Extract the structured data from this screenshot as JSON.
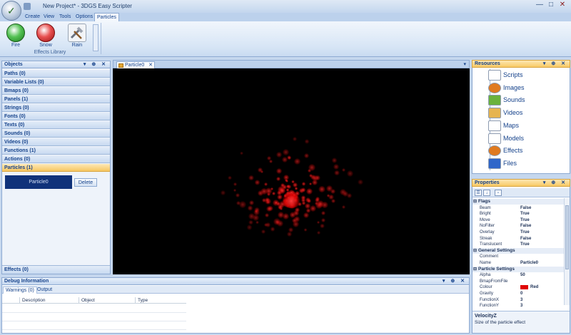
{
  "window": {
    "title": "New Project* - 3DGS Easy Scripter",
    "minimize": "—",
    "maximize": "□",
    "close": "✕"
  },
  "ribbon": {
    "tabs": [
      {
        "label": "Create",
        "active": false
      },
      {
        "label": "View",
        "active": false
      },
      {
        "label": "Tools",
        "active": false
      },
      {
        "label": "Options",
        "active": false
      },
      {
        "label": "Particles",
        "active": true
      }
    ],
    "buttons": [
      {
        "label": "Fire",
        "icon": "fire-icon"
      },
      {
        "label": "Snow",
        "icon": "snow-icon"
      },
      {
        "label": "Rain",
        "icon": "rain-icon"
      }
    ],
    "group_label": "Effects Library"
  },
  "objects_panel": {
    "title": "Objects",
    "header_buttons": "▾ ⊕ ✕",
    "categories": [
      "Paths (0)",
      "Variable Lists (0)",
      "Bmaps (0)",
      "Panels (1)",
      "Strings (0)",
      "Fonts (0)",
      "Texts (0)",
      "Sounds (0)",
      "Videos (0)",
      "Functions (1)",
      "Actions (0)",
      "Particles (1)"
    ],
    "active_category": "Particles (1)",
    "particle_item": "Particle0",
    "delete_label": "Delete",
    "bottom_category": "Effects (0)"
  },
  "document": {
    "tab_label": "Particle0",
    "tab_close": "✕",
    "dropdown": "▾"
  },
  "resources_panel": {
    "title": "Resources",
    "header_buttons": "▾ ⊕ ✕",
    "items": [
      {
        "label": "Scripts",
        "icon": "scripts-icon",
        "color": "#ffffff"
      },
      {
        "label": "Images",
        "icon": "images-icon",
        "color": "#e07a1f"
      },
      {
        "label": "Sounds",
        "icon": "sounds-icon",
        "color": "#6bb23c"
      },
      {
        "label": "Videos",
        "icon": "videos-icon",
        "color": "#e6b450"
      },
      {
        "label": "Maps",
        "icon": "maps-icon",
        "color": "#ffffff"
      },
      {
        "label": "Models",
        "icon": "models-icon",
        "color": "#ffffff"
      },
      {
        "label": "Effects",
        "icon": "effects-icon",
        "color": "#e07a1f"
      },
      {
        "label": "Files",
        "icon": "files-icon",
        "color": "#2f66c9"
      }
    ]
  },
  "properties_panel": {
    "title": "Properties",
    "header_buttons": "▾ ⊕ ✕",
    "categories": [
      {
        "name": "Flags",
        "rows": [
          {
            "name": "Beam",
            "value": "False"
          },
          {
            "name": "Bright",
            "value": "True"
          },
          {
            "name": "Move",
            "value": "True"
          },
          {
            "name": "NoFilter",
            "value": "False"
          },
          {
            "name": "Overlay",
            "value": "True"
          },
          {
            "name": "Streak",
            "value": "False"
          },
          {
            "name": "Translucent",
            "value": "True"
          }
        ]
      },
      {
        "name": "General Settings",
        "rows": [
          {
            "name": "Comment",
            "value": ""
          },
          {
            "name": "Name",
            "value": "Particle0"
          }
        ]
      },
      {
        "name": "Particle Settings",
        "rows": [
          {
            "name": "Alpha",
            "value": "50"
          },
          {
            "name": "BmapFromFile",
            "value": ""
          },
          {
            "name": "Colour",
            "value": "Red",
            "swatch": "#e00000"
          },
          {
            "name": "Gravity",
            "value": "0"
          },
          {
            "name": "FunctionX",
            "value": "3"
          },
          {
            "name": "FunctionY",
            "value": "3"
          }
        ]
      }
    ],
    "description_title": "VelocityZ",
    "description_text": "Size of the particle effect"
  },
  "debug_panel": {
    "title": "Debug Information",
    "header_buttons": "▾ ⊕ ✕",
    "tabs": [
      {
        "label": "Warnings (0)",
        "active": true
      },
      {
        "label": "Output",
        "active": false
      }
    ],
    "columns": [
      "Description",
      "Object",
      "Type"
    ]
  }
}
